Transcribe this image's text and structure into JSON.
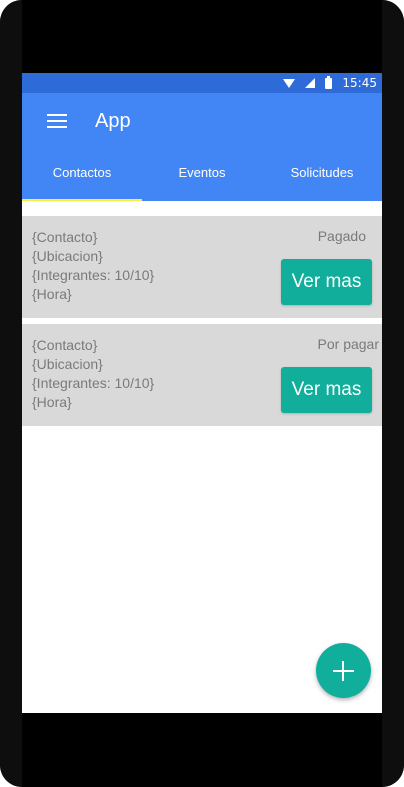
{
  "status_bar": {
    "time": "15:45",
    "icons": [
      "wifi-icon",
      "signal-icon",
      "battery-icon"
    ]
  },
  "app_bar": {
    "title": "App",
    "menu_icon": "hamburger-menu-icon"
  },
  "tabs": [
    {
      "label": "Contactos",
      "selected": true
    },
    {
      "label": "Eventos",
      "selected": false
    },
    {
      "label": "Solicitudes",
      "selected": false
    }
  ],
  "cards": [
    {
      "contacto": "{Contacto}",
      "ubicacion": "{Ubicacion}",
      "integrantes": "{Integrantes: 10/10}",
      "hora": "{Hora}",
      "status": "Pagado",
      "button": "Ver mas"
    },
    {
      "contacto": "{Contacto}",
      "ubicacion": "{Ubicacion}",
      "integrantes": "{Integrantes: 10/10}",
      "hora": "{Hora}",
      "status": "Por pagar",
      "button": "Ver mas"
    }
  ],
  "fab": {
    "icon": "plus-icon"
  },
  "colors": {
    "primary": "#4285f4",
    "primary_dark": "#2f6bd8",
    "accent": "#10ae9b",
    "card_bg": "#d9d9d9",
    "tab_indicator": "#ffeb3b"
  }
}
